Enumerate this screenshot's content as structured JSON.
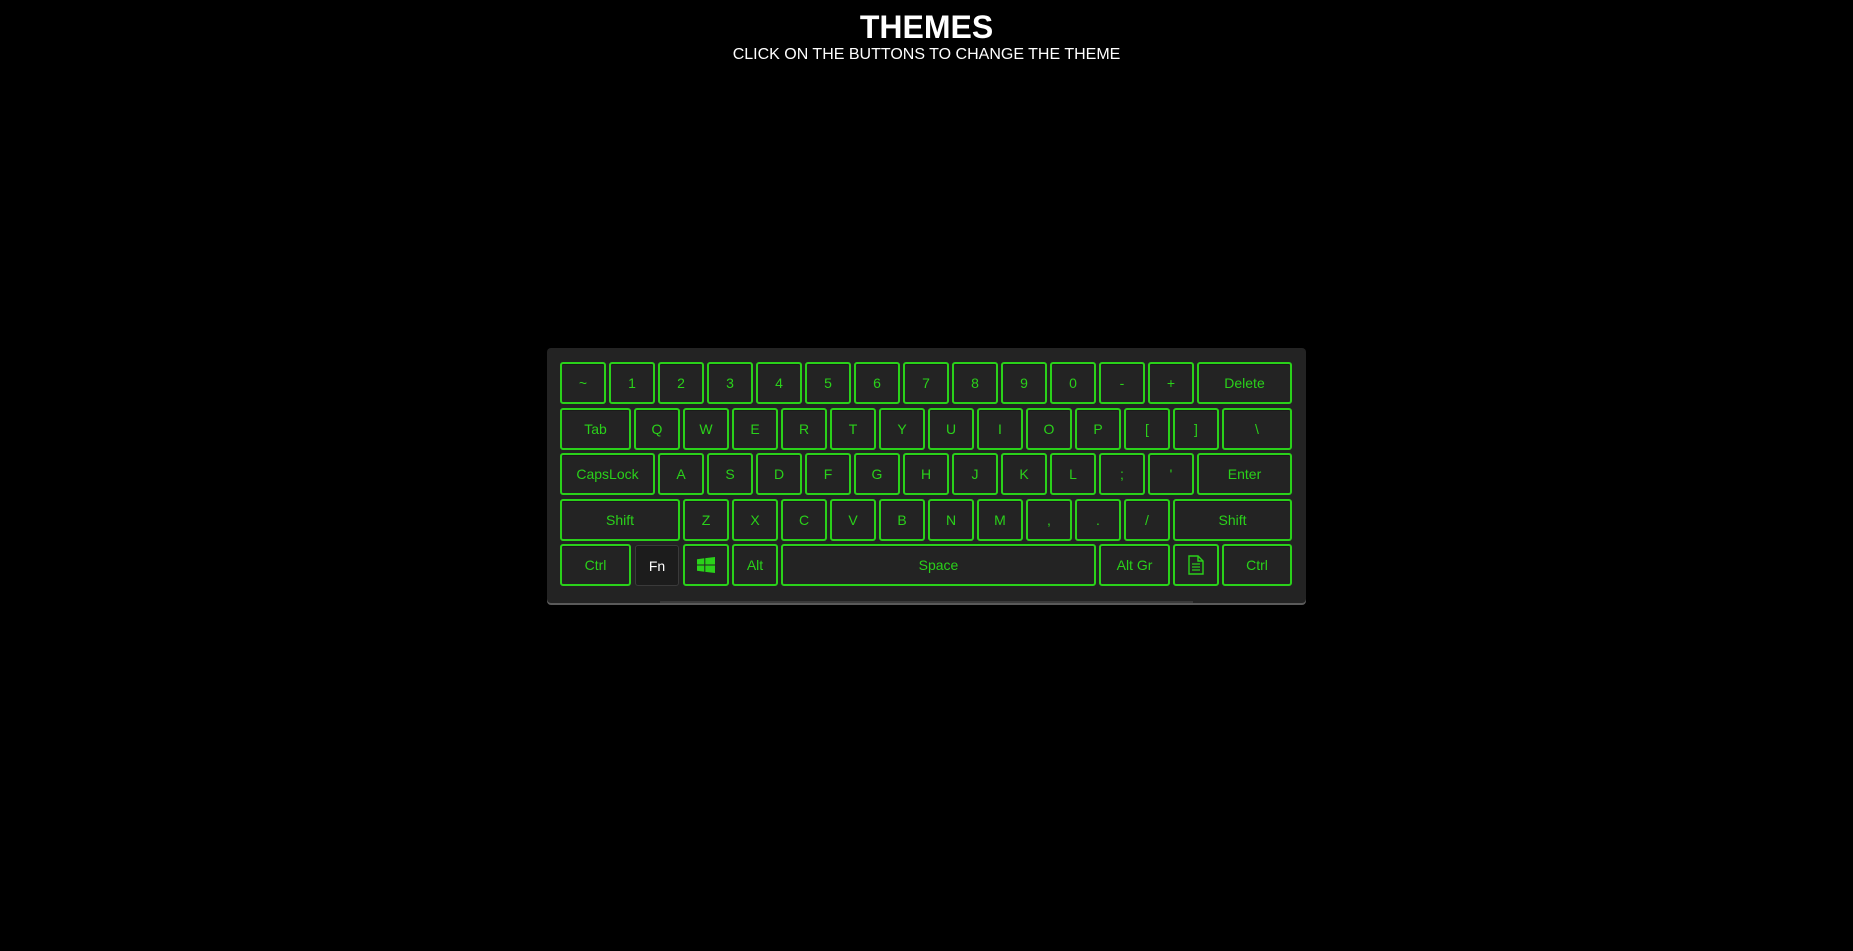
{
  "header": {
    "title": "THEMES",
    "subtitle": "CLICK ON THE BUTTONS TO CHANGE THE THEME"
  },
  "theme": {
    "accent": "#2ad11a",
    "key_background": "#232323",
    "page_background": "#000000"
  },
  "keyboard": {
    "row1": {
      "tilde": "~",
      "k1": "1",
      "k2": "2",
      "k3": "3",
      "k4": "4",
      "k5": "5",
      "k6": "6",
      "k7": "7",
      "k8": "8",
      "k9": "9",
      "k0": "0",
      "minus": "-",
      "plus": "+",
      "delete": "Delete"
    },
    "row2": {
      "tab": "Tab",
      "q": "Q",
      "w": "W",
      "e": "E",
      "r": "R",
      "t": "T",
      "y": "Y",
      "u": "U",
      "i": "I",
      "o": "O",
      "p": "P",
      "lbracket": "[",
      "rbracket": "]",
      "backslash": "\\"
    },
    "row3": {
      "capslock": "CapsLock",
      "a": "A",
      "s": "S",
      "d": "D",
      "f": "F",
      "g": "G",
      "h": "H",
      "j": "J",
      "k": "K",
      "l": "L",
      "semicolon": ";",
      "quote": "'",
      "enter": "Enter"
    },
    "row4": {
      "lshift": "Shift",
      "z": "Z",
      "x": "X",
      "c": "C",
      "v": "V",
      "b": "B",
      "n": "N",
      "m": "M",
      "comma": ",",
      "period": ".",
      "slash": "/",
      "rshift": "Shift"
    },
    "row5": {
      "lctrl": "Ctrl",
      "fn": "Fn",
      "win_icon": "windows-icon",
      "alt": "Alt",
      "space": "Space",
      "altgr": "Alt Gr",
      "menu_icon": "document-icon",
      "rctrl": "Ctrl"
    }
  }
}
